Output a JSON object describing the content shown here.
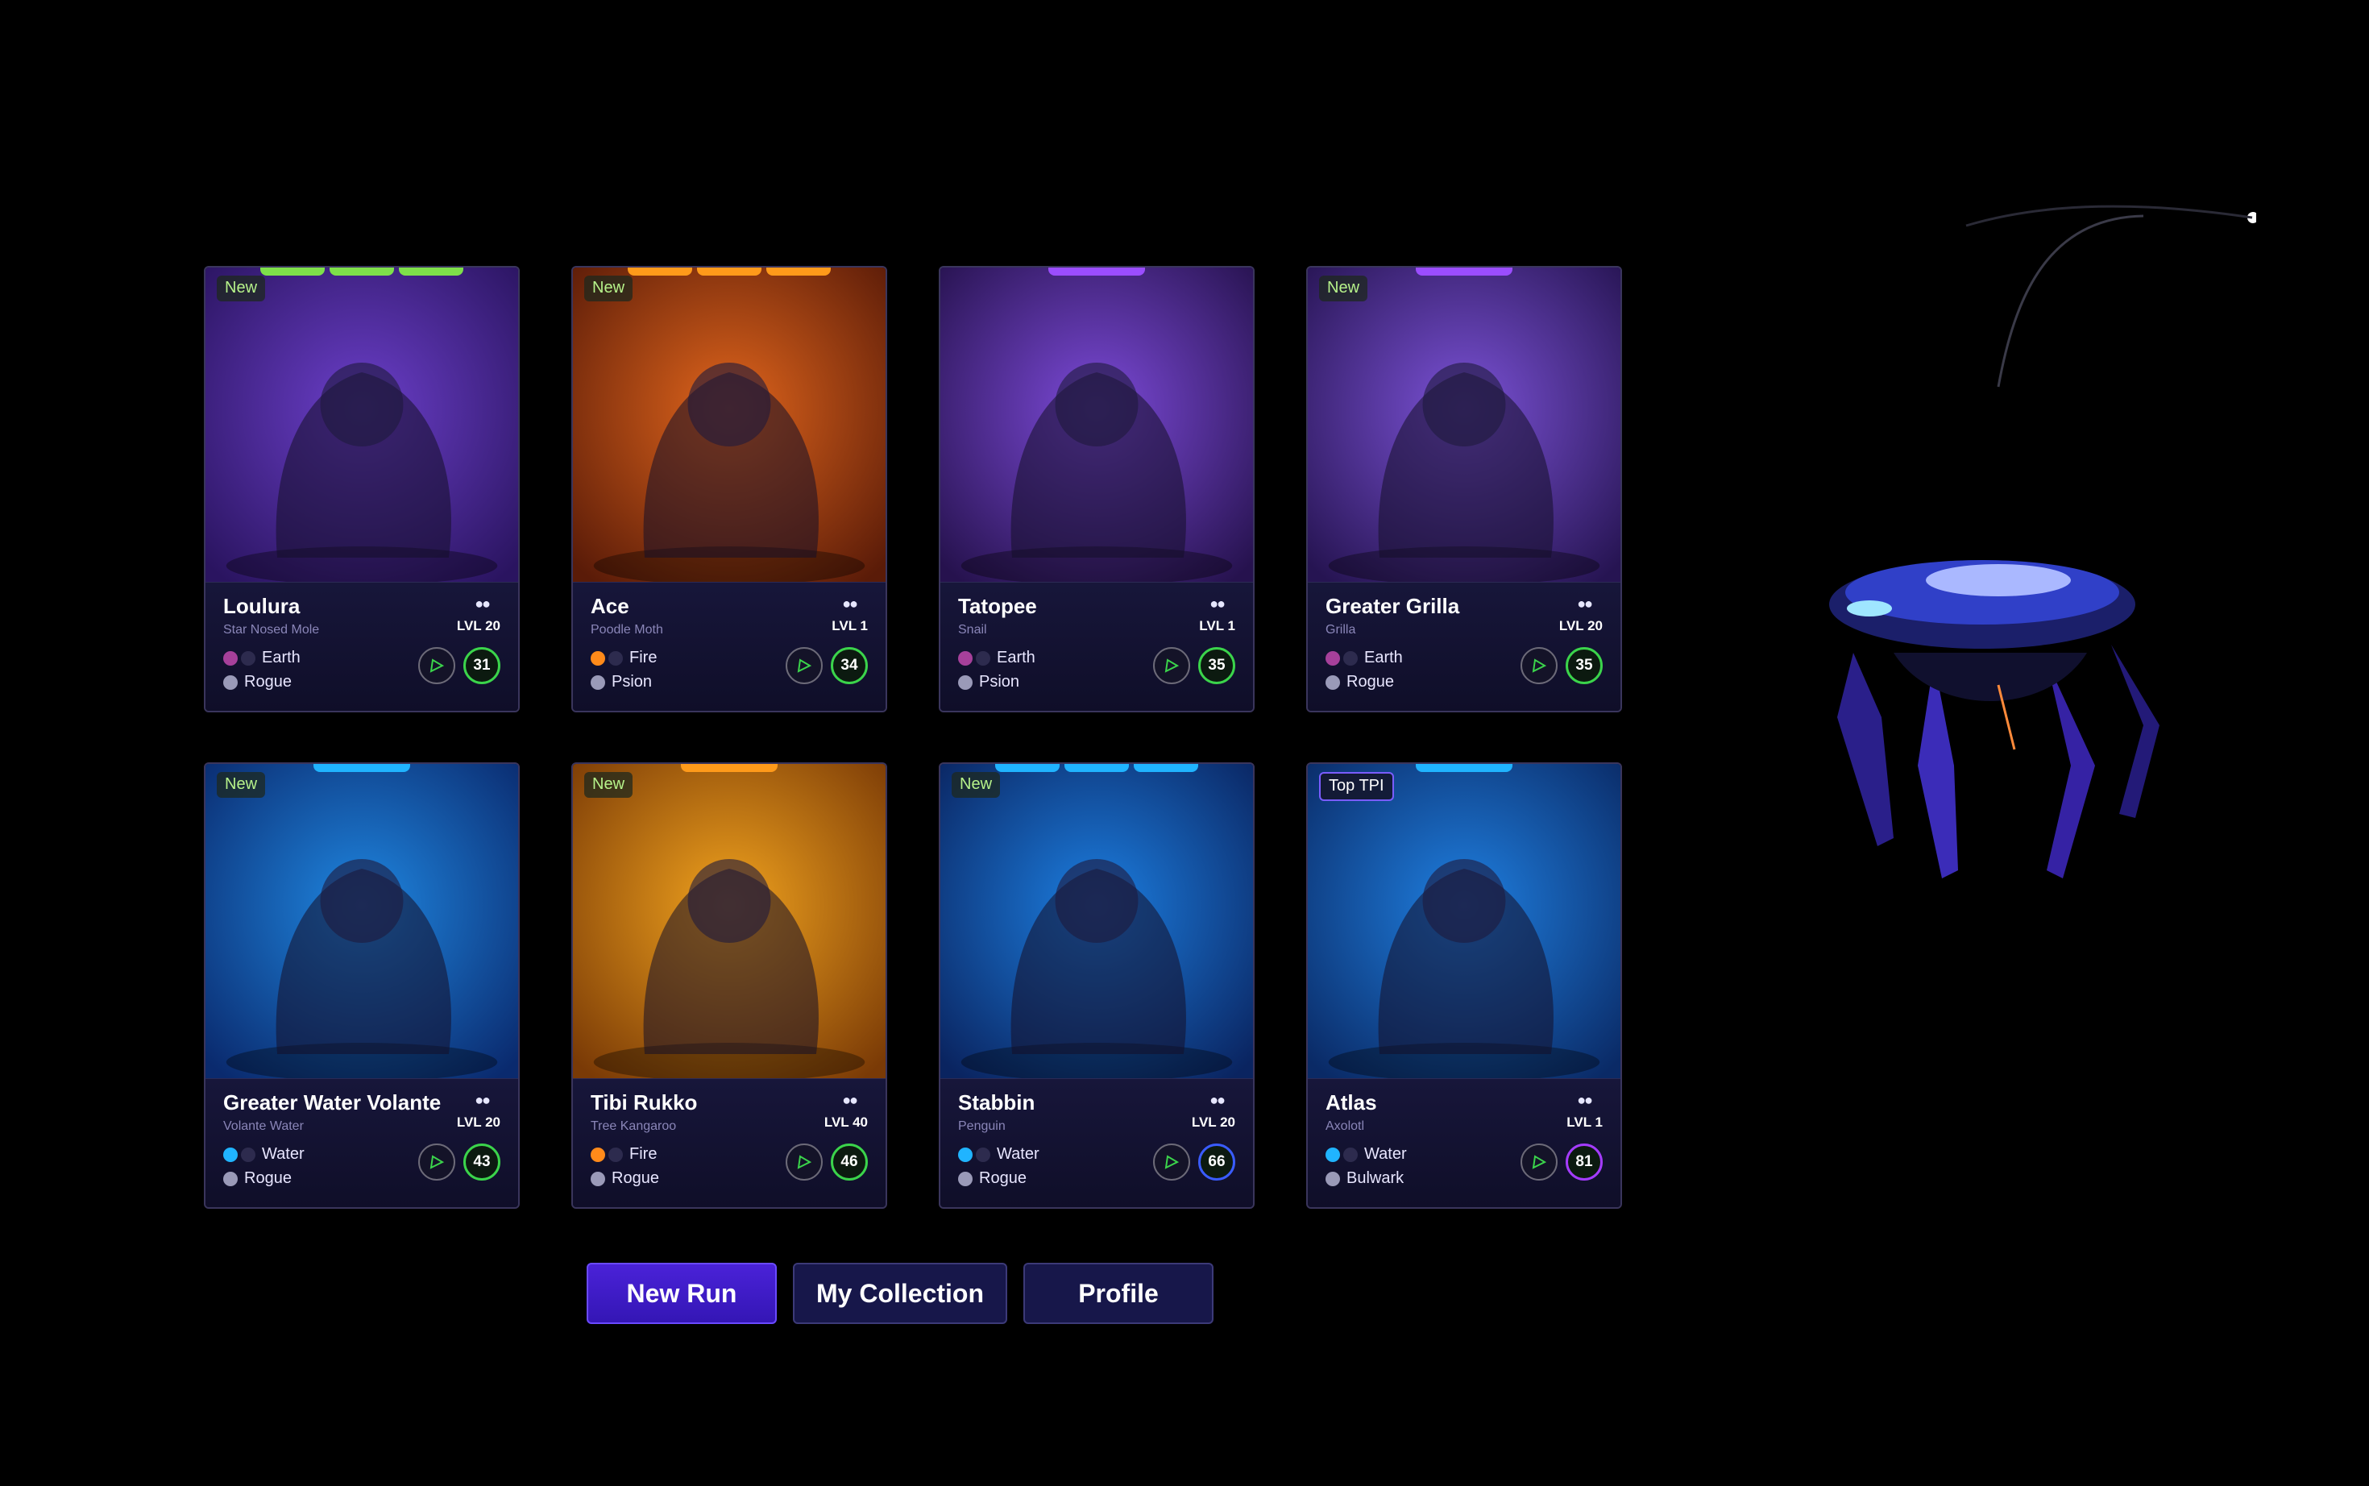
{
  "colors": {
    "earth_new": "#7ee04a",
    "fire": "#ff9a1a",
    "purple": "#9b4dff",
    "water": "#20b4ff",
    "stat_green": "#3bd44b",
    "stat_blue": "#3a5cff",
    "stat_purple": "#a43cff",
    "button_primary": "#3d1bd0"
  },
  "cards": [
    {
      "name": "Loulura",
      "species": "Star Nosed Mole",
      "level": "LVL 20",
      "badge": "New",
      "element": "Earth",
      "class": "Rogue",
      "stat": "31",
      "stat_color": "green",
      "bar_color": "#7ee04a",
      "bar_segments": 3,
      "bg": [
        "#6b3fc9",
        "#2a1460"
      ],
      "element_icon": "earth-icon",
      "class_icon": "rogue-icon"
    },
    {
      "name": "Ace",
      "species": "Poodle Moth",
      "level": "LVL 1",
      "badge": "New",
      "element": "Fire",
      "class": "Psion",
      "stat": "34",
      "stat_color": "green",
      "bar_color": "#ff9a1a",
      "bar_segments": 3,
      "bg": [
        "#e0651c",
        "#5a1b08"
      ],
      "element_icon": "fire-icon",
      "class_icon": "psion-icon"
    },
    {
      "name": "Tatopee",
      "species": "Snail",
      "level": "LVL 1",
      "badge": "",
      "element": "Earth",
      "class": "Psion",
      "stat": "35",
      "stat_color": "green",
      "bar_color": "#9b4dff",
      "bar_segments": 1,
      "bg": [
        "#7c4ad8",
        "#26124e"
      ],
      "element_icon": "earth-icon",
      "class_icon": "psion-icon"
    },
    {
      "name": "Greater Grilla",
      "species": "Grilla",
      "level": "LVL 20",
      "badge": "New",
      "element": "Earth",
      "class": "Rogue",
      "stat": "35",
      "stat_color": "green",
      "bar_color": "#9b4dff",
      "bar_segments": 1,
      "bg": [
        "#7b52d6",
        "#261452"
      ],
      "element_icon": "earth-icon",
      "class_icon": "rogue-icon"
    },
    {
      "name": "Greater Water Volante",
      "species": "Volante Water",
      "level": "LVL 20",
      "badge": "New",
      "element": "Water",
      "class": "Rogue",
      "stat": "43",
      "stat_color": "green",
      "bar_color": "#20b4ff",
      "bar_segments": 0,
      "bg": [
        "#1f86e0",
        "#0a2a6e"
      ],
      "element_icon": "water-icon",
      "class_icon": "rogue-icon"
    },
    {
      "name": "Tibi Rukko",
      "species": "Tree Kangaroo",
      "level": "LVL 40",
      "badge": "New",
      "element": "Fire",
      "class": "Rogue",
      "stat": "46",
      "stat_color": "green",
      "bar_color": "#ff9a1a",
      "bar_segments": 1,
      "bg": [
        "#f0a21e",
        "#7a3a06"
      ],
      "element_icon": "fire-icon",
      "class_icon": "rogue-icon"
    },
    {
      "name": "Stabbin",
      "species": "Penguin",
      "level": "LVL 20",
      "badge": "New",
      "element": "Water",
      "class": "Rogue",
      "stat": "66",
      "stat_color": "blue",
      "bar_color": "#20b4ff",
      "bar_segments": 3,
      "bg": [
        "#1c7ee0",
        "#0a2460"
      ],
      "element_icon": "water-icon",
      "class_icon": "rogue-icon"
    },
    {
      "name": "Atlas",
      "species": "Axolotl",
      "level": "LVL 1",
      "badge": "Top TPI",
      "element": "Water",
      "class": "Bulwark",
      "stat": "81",
      "stat_color": "purple",
      "bar_color": "#20b4ff",
      "bar_segments": 1,
      "bg": [
        "#1f7fe0",
        "#0a2a66"
      ],
      "element_icon": "water-icon",
      "class_icon": "bulwark-icon"
    }
  ],
  "buttons": {
    "new_run": "New Run",
    "my_collection": "My Collection",
    "profile": "Profile"
  }
}
